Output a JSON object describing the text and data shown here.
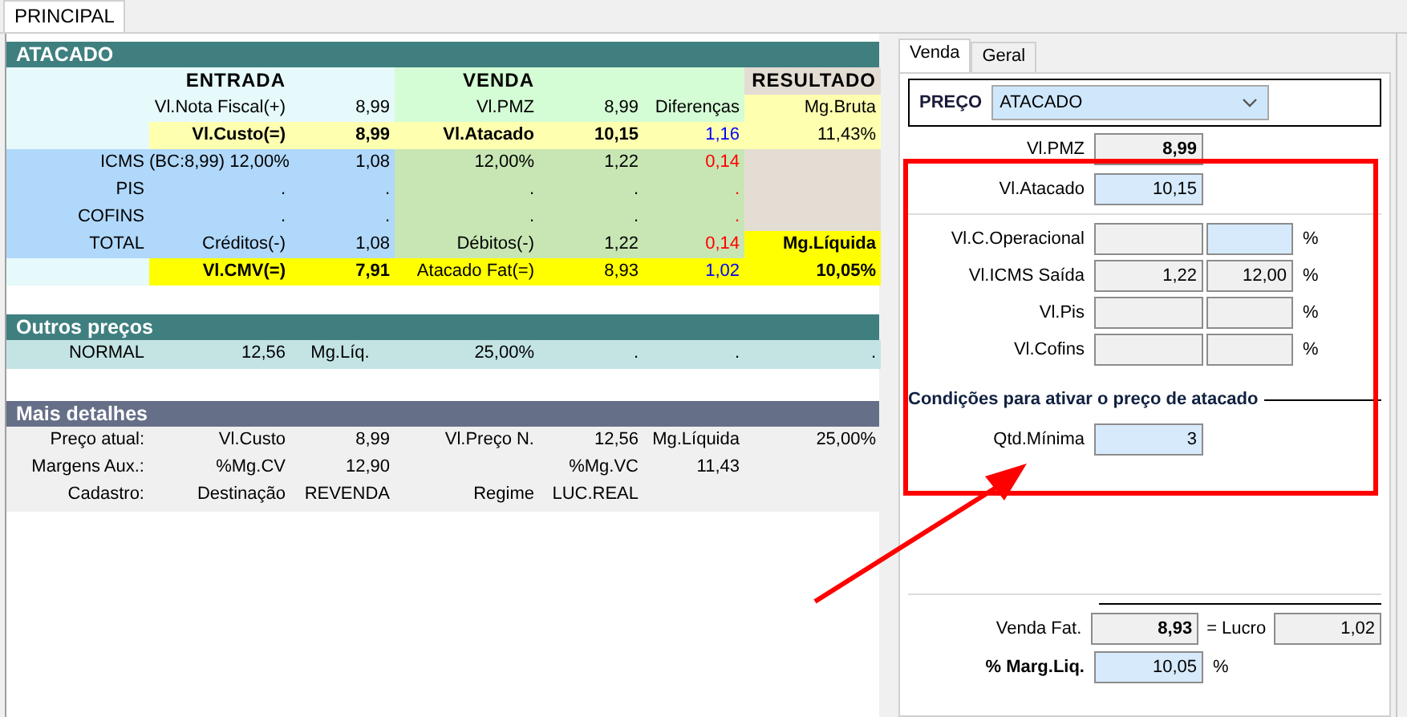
{
  "window_tabs": [
    {
      "label": "PRINCIPAL",
      "selected": true
    }
  ],
  "atacado": {
    "title": "ATACADO",
    "rows": [
      {
        "kind": "heading",
        "cells": [
          null,
          "ENTRADA",
          null,
          "VENDA",
          null,
          null,
          "RESULTADO"
        ]
      },
      {
        "kind": "line",
        "cells": [
          null,
          "Vl.Nota Fiscal(+)",
          "8,99",
          "Vl.PMZ",
          "8,99",
          "Diferenças",
          "Mg.Bruta"
        ]
      },
      {
        "kind": "subtotal",
        "cells": [
          null,
          "Vl.Custo(=)",
          "8,99",
          "Vl.Atacado",
          "10,15",
          {
            "text": "1,16",
            "color": "#0000ff"
          },
          "11,43%"
        ]
      },
      {
        "kind": "tax",
        "cells": [
          "ICMS",
          "(BC:8,99) 12,00%",
          "1,08",
          "12,00%",
          "1,22",
          {
            "text": "0,14",
            "color": "#ff0000"
          },
          null
        ]
      },
      {
        "kind": "tax",
        "cells": [
          "PIS",
          ".",
          ".",
          ".",
          ".",
          {
            "text": ".",
            "color": "#ff0000"
          },
          null
        ]
      },
      {
        "kind": "tax",
        "cells": [
          "COFINS",
          ".",
          ".",
          ".",
          ".",
          {
            "text": ".",
            "color": "#ff0000"
          },
          null
        ]
      },
      {
        "kind": "total",
        "cells": [
          "TOTAL",
          "Créditos(-)",
          "1,08",
          "Débitos(-)",
          "1,22",
          {
            "text": "0,14",
            "color": "#ff0000"
          },
          "Mg.Líquida"
        ]
      },
      {
        "kind": "final",
        "cells": [
          null,
          "Vl.CMV(=)",
          "7,91",
          "Atacado Fat(=)",
          "8,93",
          {
            "text": "1,02",
            "color": "#0000ff"
          },
          "10,05%"
        ]
      }
    ]
  },
  "outros_precos": {
    "title": "Outros preços",
    "rows": [
      [
        "NORMAL",
        "12,56",
        "Mg.Líq.",
        "25,00%",
        ".",
        ".",
        "."
      ]
    ]
  },
  "mais_detalhes": {
    "title": "Mais detalhes",
    "rows": [
      [
        "Preço atual:",
        "Vl.Custo",
        "8,99",
        "Vl.Preço N.",
        "12,56",
        "Mg.Líquida",
        "25,00%"
      ],
      [
        "Margens Aux.:",
        "%Mg.CV",
        "12,90",
        null,
        "%Mg.VC",
        "11,43",
        null
      ],
      [
        "Cadastro:",
        "Destinação",
        "REVENDA",
        "Regime",
        "LUC.REAL",
        null,
        null
      ]
    ]
  },
  "side_panel": {
    "tabs": [
      {
        "label": "Venda",
        "selected": true
      },
      {
        "label": "Geral",
        "selected": false
      }
    ],
    "preco": {
      "label": "PREÇO",
      "value": "ATACADO"
    },
    "pmz": {
      "label": "Vl.PMZ",
      "value": "8,99"
    },
    "atacado": {
      "label": "Vl.Atacado",
      "value": "10,15"
    },
    "costs": [
      {
        "label": "Vl.C.Operacional",
        "fields": [
          {
            "editable": false
          },
          {
            "editable": true
          }
        ],
        "unit": "%"
      },
      {
        "label": "Vl.ICMS Saída",
        "fields": [
          {
            "value": "1,22",
            "editable": false
          },
          {
            "value": "12,00",
            "editable": false
          }
        ],
        "unit": "%"
      },
      {
        "label": "Vl.Pis",
        "fields": [
          {
            "editable": false
          },
          {
            "editable": false
          }
        ],
        "unit": "%"
      },
      {
        "label": "Vl.Cofins",
        "fields": [
          {
            "editable": false
          },
          {
            "editable": false
          }
        ],
        "unit": "%"
      }
    ],
    "conditions": {
      "title": "Condições para ativar o preço de atacado",
      "label": "Qtd.Mínima",
      "value": "3"
    },
    "venda_fat": {
      "label": "Venda Fat.",
      "value": "8,93"
    },
    "lucro": {
      "label": "= Lucro",
      "value": "1,02"
    },
    "marg_liq": {
      "label": "% Marg.Liq.",
      "value": "10,05",
      "unit": "%"
    }
  }
}
